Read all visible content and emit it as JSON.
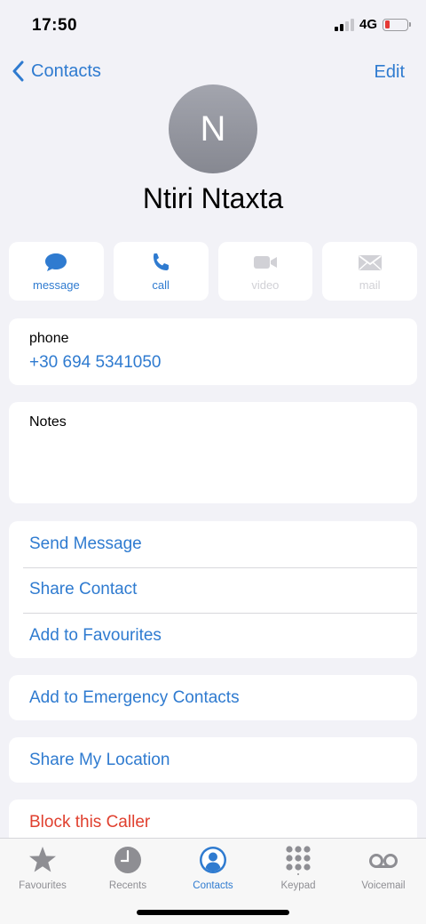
{
  "status_bar": {
    "time": "17:50",
    "network": "4G"
  },
  "nav": {
    "back_label": "Contacts",
    "edit_label": "Edit"
  },
  "contact": {
    "initial": "N",
    "name": "Ntiri Ntaxta"
  },
  "actions": [
    {
      "label": "message",
      "icon": "message-bubble-icon",
      "enabled": true
    },
    {
      "label": "call",
      "icon": "phone-icon",
      "enabled": true
    },
    {
      "label": "video",
      "icon": "video-camera-icon",
      "enabled": false
    },
    {
      "label": "mail",
      "icon": "envelope-icon",
      "enabled": false
    }
  ],
  "phone": {
    "label": "phone",
    "number": "+30 694 5341050"
  },
  "notes": {
    "label": "Notes"
  },
  "list": [
    "Send Message",
    "Share Contact",
    "Add to Favourites"
  ],
  "emergency_label": "Add to Emergency Contacts",
  "location_label": "Share My Location",
  "block_label": "Block this Caller",
  "tabs": [
    {
      "label": "Favourites",
      "icon": "star-icon",
      "active": false
    },
    {
      "label": "Recents",
      "icon": "clock-icon",
      "active": false
    },
    {
      "label": "Contacts",
      "icon": "person-circle-icon",
      "active": true
    },
    {
      "label": "Keypad",
      "icon": "keypad-icon",
      "active": false
    },
    {
      "label": "Voicemail",
      "icon": "voicemail-icon",
      "active": false
    }
  ],
  "colors": {
    "accent": "#2f7bd0",
    "destructive": "#e0402f",
    "background": "#f2f2f7",
    "inactive": "#8e8e93"
  }
}
